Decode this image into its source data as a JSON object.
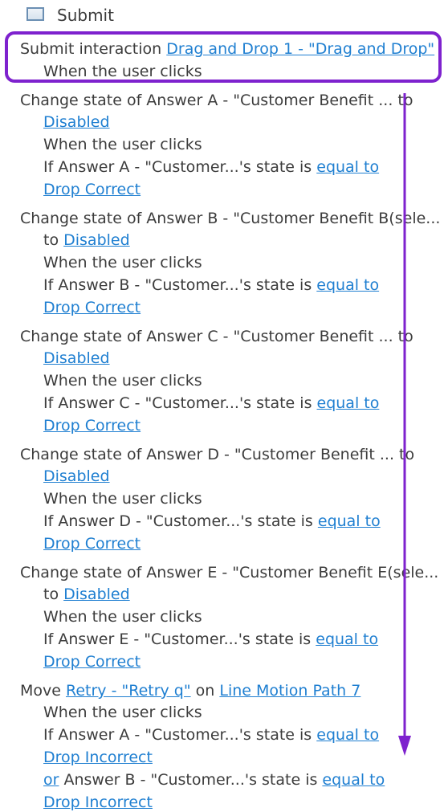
{
  "header": {
    "label": "Submit",
    "icon": "checkbox-icon"
  },
  "actions": [
    {
      "lines": [
        [
          {
            "text": "Submit interaction "
          },
          {
            "text": "Drag and Drop 1 - \"Drag and Drop\"",
            "link": true
          }
        ],
        [
          {
            "text": "When the user clicks"
          }
        ]
      ]
    },
    {
      "lines": [
        [
          {
            "text": "Change state of Answer A - \"Customer Benefit ... to"
          }
        ],
        [
          {
            "text": "Disabled",
            "link": true
          }
        ],
        [
          {
            "text": "When the user clicks"
          }
        ],
        [
          {
            "text": "If Answer A - \"Customer...'s state is "
          },
          {
            "text": "equal to",
            "link": true
          }
        ],
        [
          {
            "text": "Drop Correct",
            "link": true
          }
        ]
      ]
    },
    {
      "lines": [
        [
          {
            "text": "Change state of Answer B - \"Customer Benefit B(sele..."
          }
        ],
        [
          {
            "text": "to "
          },
          {
            "text": "Disabled",
            "link": true
          }
        ],
        [
          {
            "text": "When the user clicks"
          }
        ],
        [
          {
            "text": "If Answer B - \"Customer...'s state is "
          },
          {
            "text": "equal to",
            "link": true
          }
        ],
        [
          {
            "text": "Drop Correct",
            "link": true
          }
        ]
      ]
    },
    {
      "lines": [
        [
          {
            "text": "Change state of Answer C - \"Customer Benefit ... to"
          }
        ],
        [
          {
            "text": "Disabled",
            "link": true
          }
        ],
        [
          {
            "text": "When the user clicks"
          }
        ],
        [
          {
            "text": "If Answer C - \"Customer...'s state is "
          },
          {
            "text": "equal to",
            "link": true
          }
        ],
        [
          {
            "text": "Drop Correct",
            "link": true
          }
        ]
      ]
    },
    {
      "lines": [
        [
          {
            "text": "Change state of Answer D - \"Customer Benefit ... to"
          }
        ],
        [
          {
            "text": "Disabled",
            "link": true
          }
        ],
        [
          {
            "text": "When the user clicks"
          }
        ],
        [
          {
            "text": "If Answer D - \"Customer...'s state is "
          },
          {
            "text": "equal to",
            "link": true
          }
        ],
        [
          {
            "text": "Drop Correct",
            "link": true
          }
        ]
      ]
    },
    {
      "lines": [
        [
          {
            "text": "Change state of Answer E - \"Customer Benefit E(sele..."
          }
        ],
        [
          {
            "text": "to "
          },
          {
            "text": "Disabled",
            "link": true
          }
        ],
        [
          {
            "text": "When the user clicks"
          }
        ],
        [
          {
            "text": "If Answer E - \"Customer...'s state is "
          },
          {
            "text": "equal to",
            "link": true
          }
        ],
        [
          {
            "text": "Drop Correct",
            "link": true
          }
        ]
      ]
    },
    {
      "lines": [
        [
          {
            "text": "Move "
          },
          {
            "text": "Retry - \"Retry q\"",
            "link": true
          },
          {
            "text": " on "
          },
          {
            "text": "Line Motion Path 7",
            "link": true
          }
        ],
        [
          {
            "text": "When the user clicks"
          }
        ],
        [
          {
            "text": "If Answer A - \"Customer...'s state is "
          },
          {
            "text": "equal to",
            "link": true
          }
        ],
        [
          {
            "text": "Drop Incorrect",
            "link": true
          }
        ],
        [
          {
            "text": "or",
            "link": true
          },
          {
            "text": " Answer B - \"Customer...'s state is "
          },
          {
            "text": "equal to",
            "link": true
          }
        ],
        [
          {
            "text": "Drop Incorrect",
            "link": true
          }
        ]
      ]
    }
  ],
  "colors": {
    "text": "#3c3c3c",
    "link": "#1f7fd1",
    "highlight": "#7e22ce"
  }
}
